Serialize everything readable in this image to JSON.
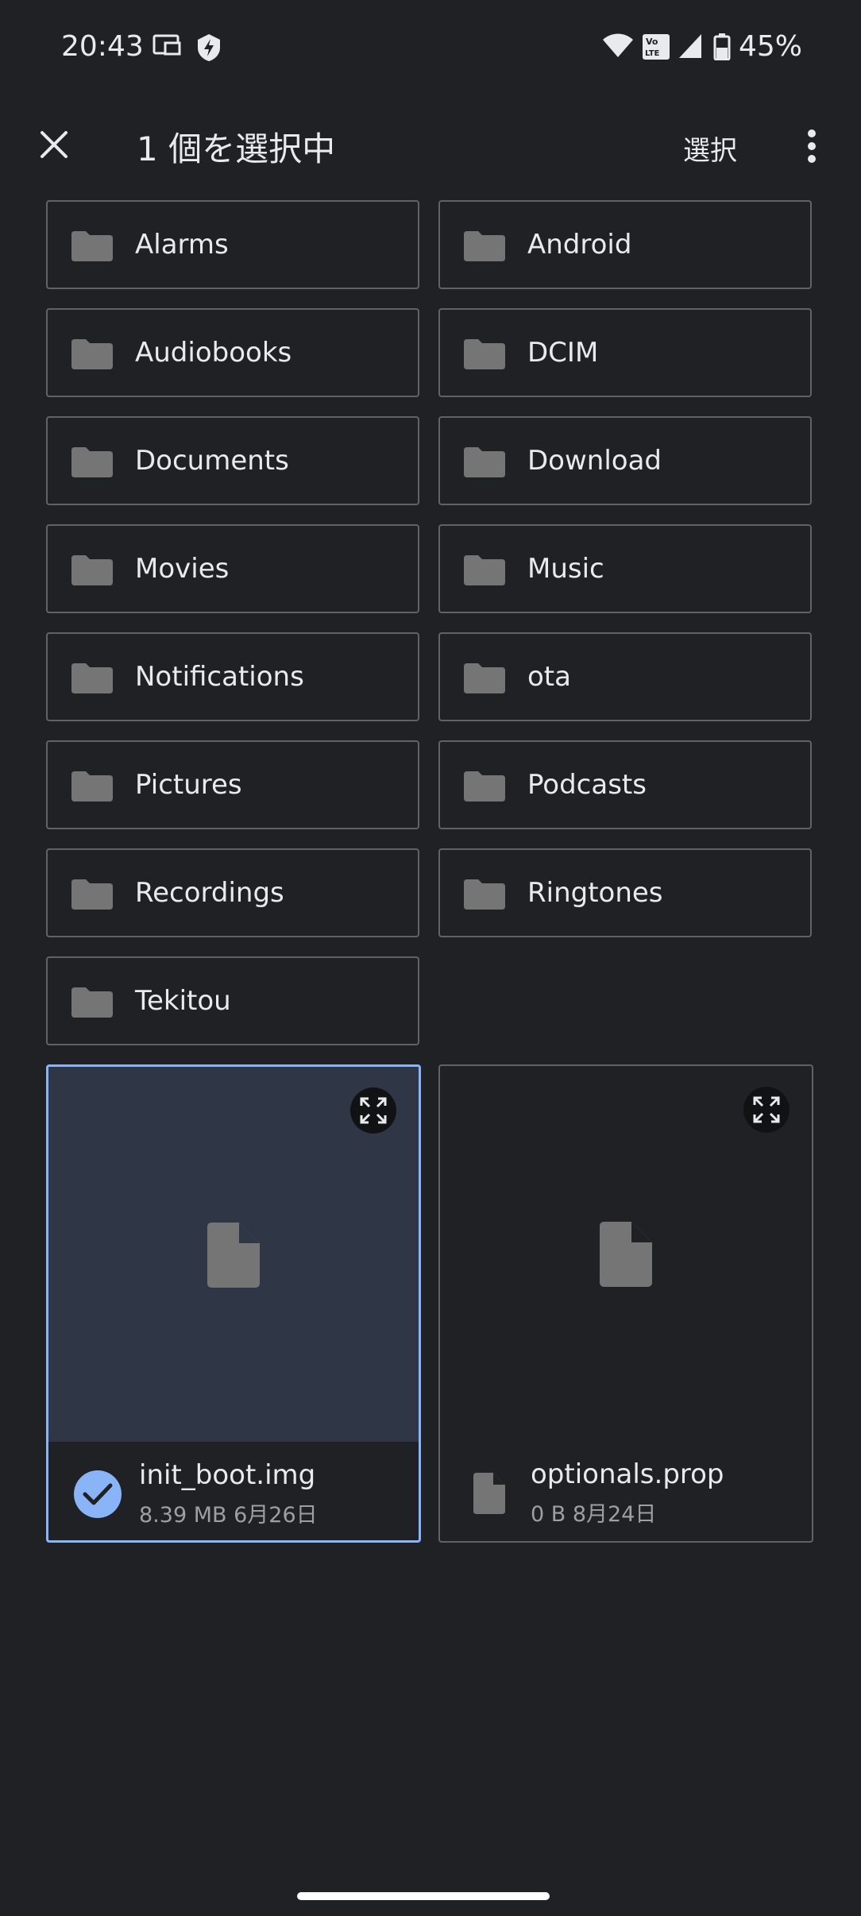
{
  "status_bar": {
    "time": "20:43",
    "battery": "45%",
    "icons": [
      "cast-icon",
      "shield-bolt-icon",
      "wifi-icon",
      "volte-icon",
      "signal-icon",
      "battery-icon"
    ]
  },
  "app_bar": {
    "title": "1 個を選択中",
    "select_label": "選択",
    "icons": [
      "close-icon",
      "more-vert-icon"
    ]
  },
  "folders": [
    {
      "label": "Alarms"
    },
    {
      "label": "Android"
    },
    {
      "label": "Audiobooks"
    },
    {
      "label": "DCIM"
    },
    {
      "label": "Documents"
    },
    {
      "label": "Download"
    },
    {
      "label": "Movies"
    },
    {
      "label": "Music"
    },
    {
      "label": "Notifications"
    },
    {
      "label": "ota"
    },
    {
      "label": "Pictures"
    },
    {
      "label": "Podcasts"
    },
    {
      "label": "Recordings"
    },
    {
      "label": "Ringtones"
    },
    {
      "label": "Tekitou"
    }
  ],
  "files": [
    {
      "name": "init_boot.img",
      "meta": "8.39 MB 6月26日",
      "selected": true
    },
    {
      "name": "optionals.prop",
      "meta": "0 B 8月24日",
      "selected": false
    }
  ],
  "colors": {
    "background": "#202124",
    "accent": "#8ab4f8",
    "border": "#5f6368",
    "icon_gray": "#757575",
    "selected_bg": "#2f3645"
  }
}
